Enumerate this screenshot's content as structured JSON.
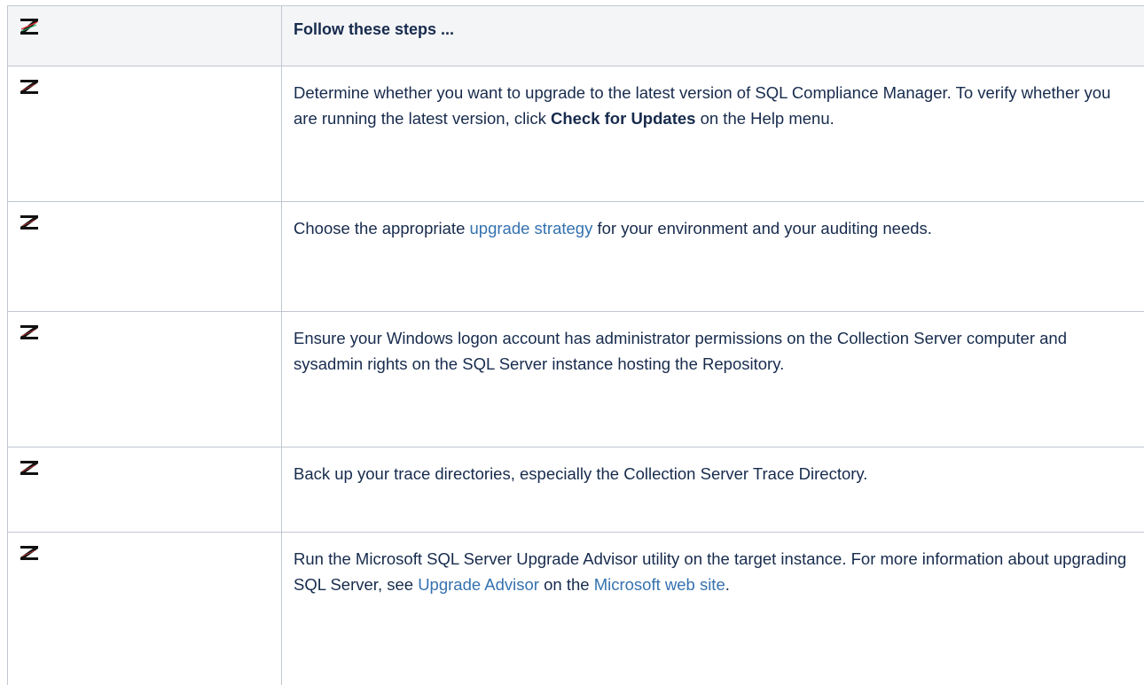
{
  "table": {
    "header": {
      "steps_title": "Follow these steps ..."
    },
    "rows": [
      {
        "icon": "checkbox-icon",
        "text_before": "Determine whether you want to upgrade to the latest version of SQL Compliance Manager. To verify whether you are running the latest version, click ",
        "bold": "Check for Updates",
        "text_after": " on the Help menu."
      },
      {
        "icon": "checkbox-icon",
        "text_before": "Choose the appropriate ",
        "link": "upgrade strategy",
        "text_after": " for your environment and your auditing needs."
      },
      {
        "icon": "checkbox-icon",
        "text": "Ensure your Windows logon account has administrator permissions on the Collection Server computer and sysadmin rights on the SQL Server instance hosting the Repository."
      },
      {
        "icon": "checkbox-icon",
        "text": "Back up your trace directories, especially the Collection Server Trace Directory."
      },
      {
        "icon": "checkbox-icon",
        "text_before": "Run the Microsoft SQL Server Upgrade Advisor utility on the target instance. For more information about upgrading SQL Server, see ",
        "link1": "Upgrade Advisor",
        "text_middle": " on the ",
        "link2": "Microsoft web site",
        "text_after": "."
      }
    ]
  },
  "colors": {
    "link": "#3572b0",
    "header_bg": "#f4f5f7",
    "border": "#c1c7d0",
    "text": "#172b4d"
  }
}
